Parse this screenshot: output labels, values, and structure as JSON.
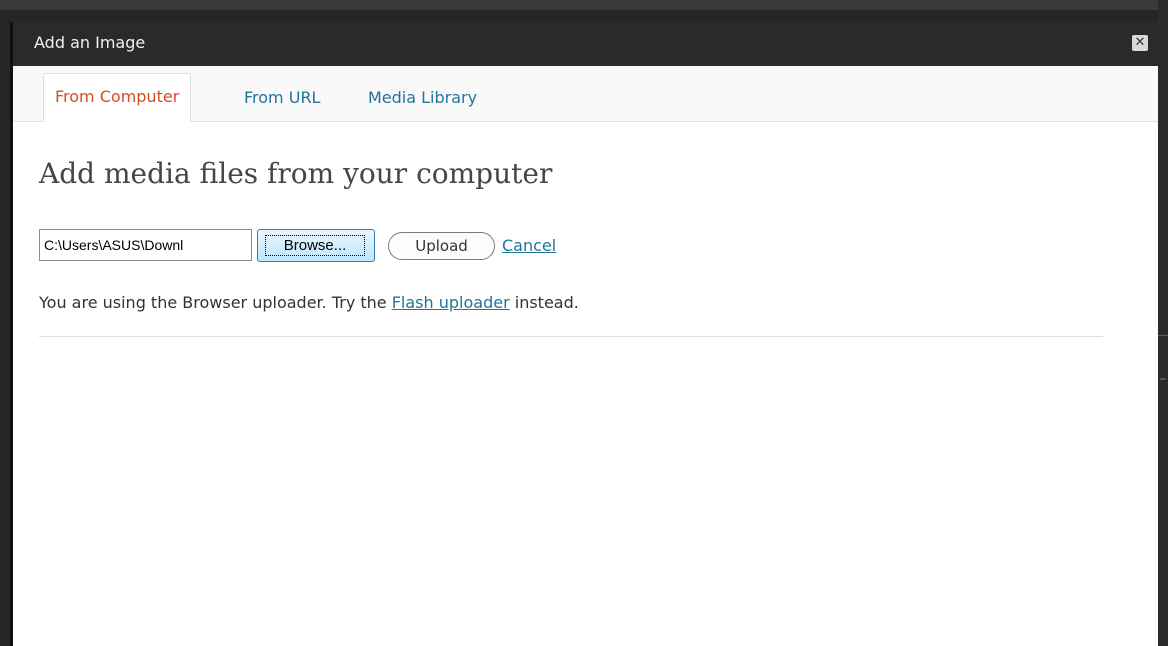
{
  "dialog": {
    "title": "Add an Image",
    "close_symbol": "✕"
  },
  "tabs": [
    {
      "label": "From Computer",
      "active": true
    },
    {
      "label": "From URL",
      "active": false
    },
    {
      "label": "Media Library",
      "active": false
    }
  ],
  "main": {
    "heading": "Add media files from your computer",
    "file_input_value": "C:\\Users\\ASUS\\Downl",
    "browse_label": "Browse...",
    "upload_label": "Upload",
    "cancel_label": "Cancel",
    "notice_prefix": "You are using the Browser uploader. Try the ",
    "notice_link": "Flash uploader",
    "notice_suffix": " instead."
  },
  "colors": {
    "active_tab": "#d54e21",
    "link": "#21759b",
    "titlebar": "#2a2a2a"
  },
  "icons": {
    "close": "close-icon"
  }
}
